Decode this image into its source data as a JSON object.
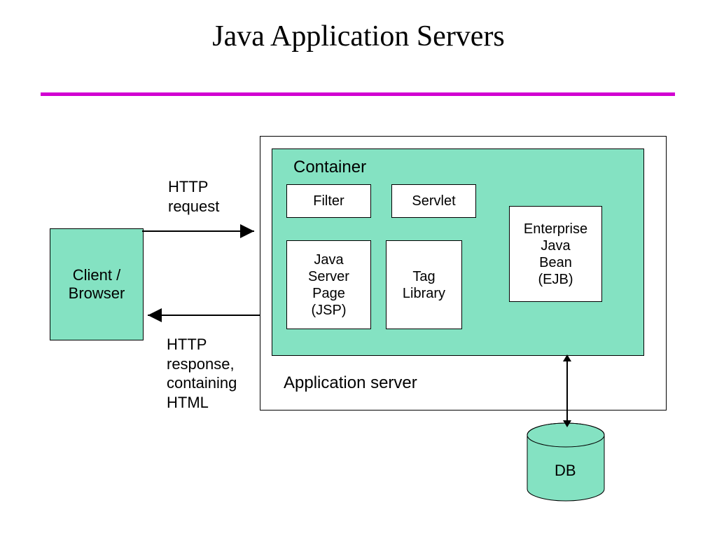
{
  "title": "Java Application Servers",
  "client_box_l1": "Client /",
  "client_box_l2": "Browser",
  "http_request_l1": "HTTP",
  "http_request_l2": "request",
  "http_response_l1": "HTTP",
  "http_response_l2": "response,",
  "http_response_l3": "containing",
  "http_response_l4": "HTML",
  "container_label": "Container",
  "filter_label": "Filter",
  "servlet_label": "Servlet",
  "jsp_l1": "Java",
  "jsp_l2": "Server",
  "jsp_l3": "Page",
  "jsp_l4": "(JSP)",
  "tag_l1": "Tag",
  "tag_l2": "Library",
  "ejb_l1": "Enterprise",
  "ejb_l2": "Java",
  "ejb_l3": "Bean",
  "ejb_l4": "(EJB)",
  "appserver_label": "Application server",
  "db_label": "DB"
}
